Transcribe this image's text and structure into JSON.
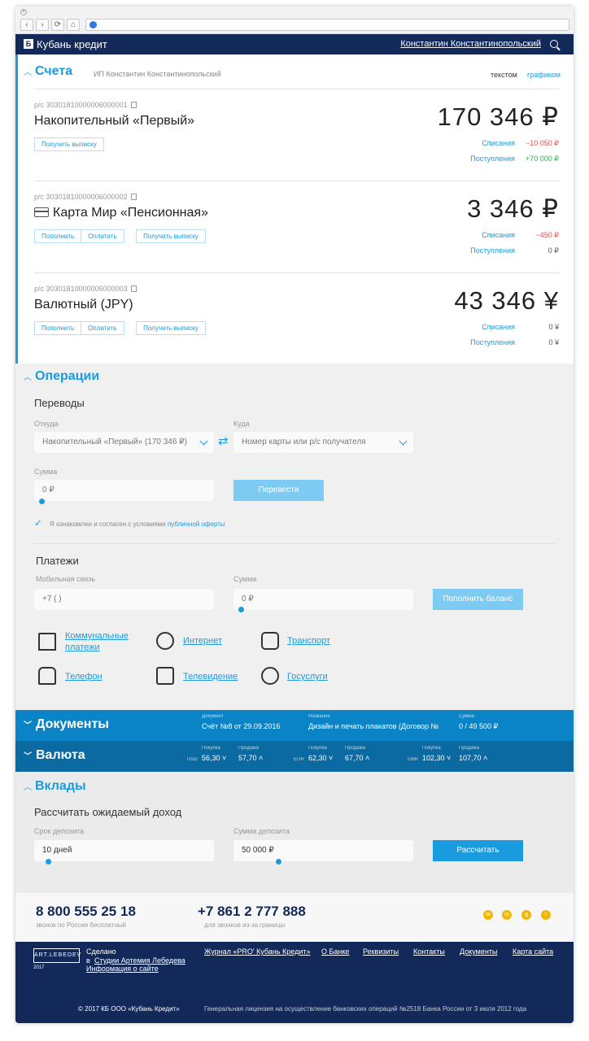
{
  "topbar": {
    "brand": "Кубань кредит",
    "user": "Константин Константинопольский"
  },
  "accounts": {
    "title": "Счета",
    "subtitle": "ИП Константин Константинопольский",
    "view_text": "текстом",
    "view_graph": "графиком",
    "debits_label": "Списания",
    "credits_label": "Поступления",
    "items": [
      {
        "num": "р/с 30301810000006000001",
        "name": "Накопительный «Первый»",
        "balance": "170 346 ₽",
        "debit": "−10 050 ₽",
        "credit": "+70 000 ₽",
        "btn_statement": "Получить выписку"
      },
      {
        "num": "р/с 30301810000006000002",
        "name": "Карта Мир «Пенсионная»",
        "balance": "3 346 ₽",
        "debit": "−450 ₽",
        "credit": "0 ₽",
        "btn_topup": "Пополнить",
        "btn_pay": "Оплатить",
        "btn_statement": "Получить выписку"
      },
      {
        "num": "р/с 30301810000006000003",
        "name": "Валютный (JPY)",
        "balance": "43 346 ¥",
        "debit": "0 ¥",
        "credit": "0 ¥",
        "btn_topup": "Пополнить",
        "btn_pay": "Оплатить",
        "btn_statement": "Получить выписку"
      }
    ]
  },
  "operations": {
    "title": "Операции",
    "transfers": "Переводы",
    "from_label": "Откуда",
    "from_value": "Накопительный «Первый» (170 346 ₽)",
    "to_label": "Куда",
    "to_placeholder": "Номер карты или р/с получателя",
    "amount_label": "Сумма",
    "amount_value": "0 ₽",
    "transfer_btn": "Перевести",
    "agree_text": "Я ознакомлен и согласен с условиями",
    "agree_link": "публичной оферты",
    "payments": "Платежи",
    "mobile_label": "Мобильная связь",
    "mobile_value": "+7 (  )",
    "pay_amount_label": "Сумма",
    "pay_amount_value": "0 ₽",
    "topup_btn": "Пополнить баланс",
    "services": [
      {
        "line1": "Коммунальные",
        "line2": "платежи"
      },
      {
        "line1": "Интернет",
        "line2": ""
      },
      {
        "line1": "Транспорт",
        "line2": ""
      },
      {
        "line1": "Телефон",
        "line2": ""
      },
      {
        "line1": "Телевидение",
        "line2": ""
      },
      {
        "line1": "Госуслуги",
        "line2": ""
      }
    ]
  },
  "documents": {
    "title": "Документы",
    "doc_label": "Документ",
    "doc_value": "Счёт №8 от 29.09.2016",
    "name_label": "Название",
    "name_value": "Дизайн и печать плакатов (Договор №",
    "sum_label": "Сумма",
    "sum_value": "0 / 49 500 ₽"
  },
  "currency": {
    "title": "Валюта",
    "buy_label": "Покупка",
    "sell_label": "Продажа",
    "rates": [
      {
        "code": "USD",
        "buy": "56,30",
        "sell": "57,70"
      },
      {
        "code": "EUR",
        "buy": "62,30",
        "sell": "67,70"
      },
      {
        "code": "GBR",
        "buy": "102,30",
        "sell": "107,70"
      }
    ]
  },
  "deposits": {
    "title": "Вклады",
    "subtitle": "Рассчитать ожидаемый доход",
    "term_label": "Срок депозита",
    "term_value": "10 дней",
    "sum_label": "Сумма депозита",
    "sum_value": "50 000 ₽",
    "calc_btn": "Рассчитать"
  },
  "contacts": {
    "phone1": "8 800 555 25 18",
    "phone1_sub": "звонок по России бесплатный",
    "phone2": "+7 861 2 777 888",
    "phone2_sub": "для звонков из-за границы"
  },
  "footer": {
    "logo": "ART.LEBEDEV",
    "logo_year": "2017",
    "made": "Сделано",
    "made_in": "в",
    "studio": "Студии Артемия Лебедева",
    "info": "Информация о сайте",
    "links": [
      "Журнал «PRO' Кубань Кредит»",
      "О Банке",
      "Реквизиты",
      "Контакты",
      "Документы",
      "Карта сайта"
    ],
    "copyright": "© 2017 КБ ООО «Кубань Кредит»",
    "license": "Генеральная лицензия на осуществление банковских операций №2518 Банка России от 3 июля 2012 года"
  },
  "colors": {
    "brand_navy": "#12295a",
    "accent_blue": "#1a9be0",
    "docs_bar": "#0a84c6",
    "currency_bar": "#0b6aa2"
  }
}
